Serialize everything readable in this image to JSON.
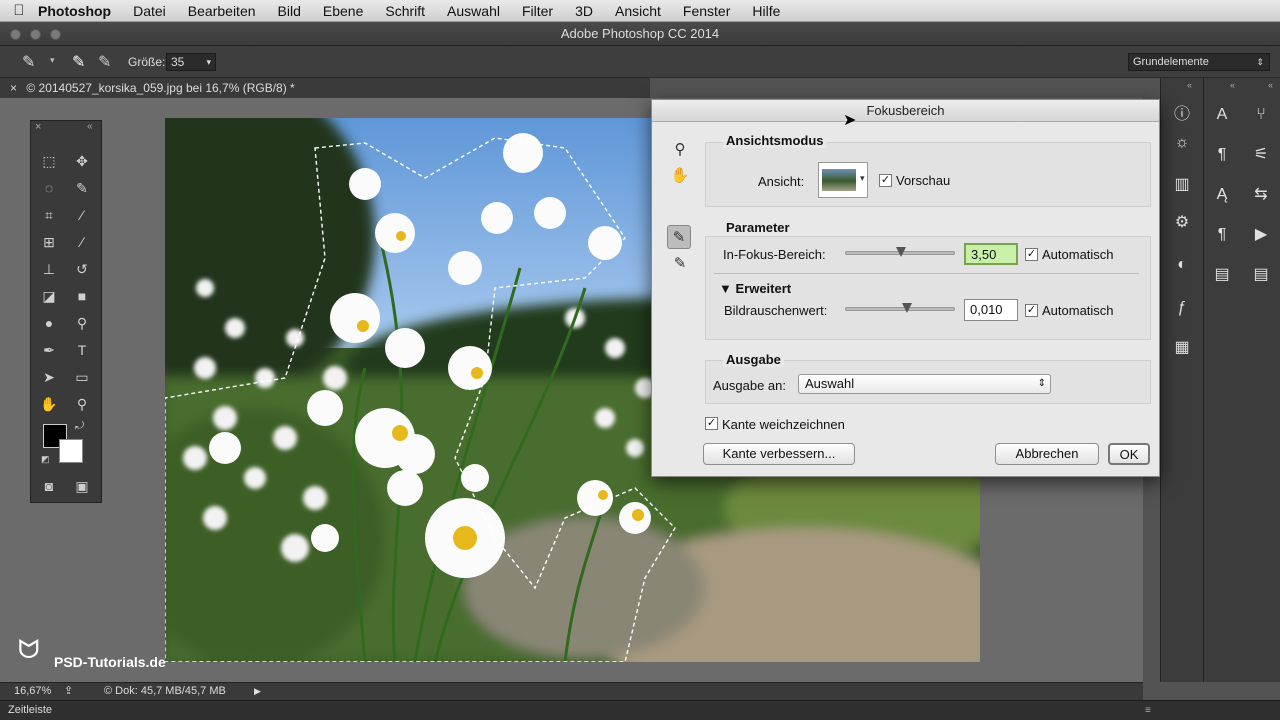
{
  "menubar": {
    "items": [
      "Photoshop",
      "Datei",
      "Bearbeiten",
      "Bild",
      "Ebene",
      "Schrift",
      "Auswahl",
      "Filter",
      "3D",
      "Ansicht",
      "Fenster",
      "Hilfe"
    ]
  },
  "window": {
    "title": "Adobe Photoshop CC 2014"
  },
  "options": {
    "size_label": "Größe:",
    "size_value": "35",
    "workspace": "Grundelemente"
  },
  "document": {
    "tab_title": "© 20140527_korsika_059.jpg bei 16,7% (RGB/8) *"
  },
  "status": {
    "zoom": "16,67%",
    "doc_info": "© Dok: 45,7 MB/45,7 MB"
  },
  "timeline": {
    "label": "Zeitleiste"
  },
  "watermark": {
    "text": "PSD-Tutorials.de"
  },
  "dialog": {
    "title": "Fokusbereich",
    "view_mode": {
      "heading": "Ansichtsmodus",
      "view_label": "Ansicht:",
      "preview_label": "Vorschau",
      "preview_checked": true
    },
    "parameters": {
      "heading": "Parameter",
      "focus_label": "In-Fokus-Bereich:",
      "focus_value": "3,50",
      "focus_auto_label": "Automatisch",
      "focus_slider_level": 0.5,
      "advanced_label": "Erweitert",
      "noise_label": "Bildrauschenwert:",
      "noise_value": "0,010",
      "noise_auto_label": "Automatisch",
      "noise_slider_level": 0.55
    },
    "output": {
      "heading": "Ausgabe",
      "output_label": "Ausgabe an:",
      "output_value": "Auswahl"
    },
    "soften_label": "Kante weichzeichnen",
    "refine_button": "Kante verbessern...",
    "cancel_button": "Abbrechen",
    "ok_button": "OK"
  },
  "colors": {
    "accent_highlight": "#c8f0a8",
    "ui_dark": "#3c3c3c"
  }
}
